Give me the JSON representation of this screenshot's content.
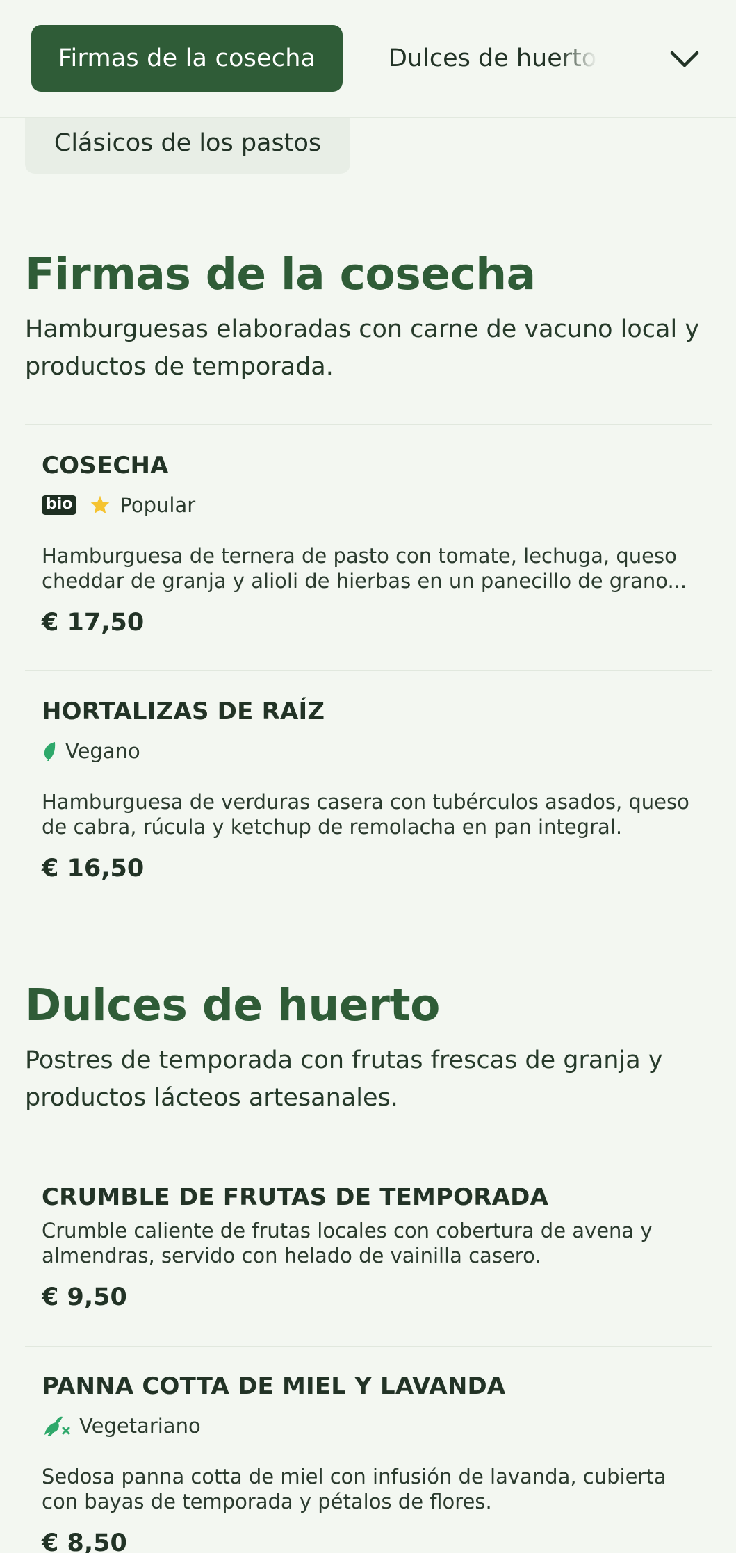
{
  "nav": {
    "tabs": [
      {
        "label": "Firmas de la cosecha",
        "active": true
      },
      {
        "label": "Dulces de huerto",
        "active": false
      },
      {
        "label": "Clásicos de los pastos",
        "active": false
      }
    ],
    "expand_icon": "chevron-down-icon"
  },
  "sections": [
    {
      "title": "Firmas de la cosecha",
      "description": "Hamburguesas elaboradas con carne de vacuno local y productos de temporada.",
      "items": [
        {
          "name": "COSECHA",
          "tags": [
            {
              "type": "bio",
              "label": "bio"
            },
            {
              "type": "star-icon",
              "label": "Popular"
            }
          ],
          "description": "Hamburguesa de ternera de pasto con tomate, lechuga, queso cheddar de granja y alioli de hierbas en un panecillo de grano...",
          "price": "€ 17,50"
        },
        {
          "name": "HORTALIZAS DE RAÍZ",
          "tags": [
            {
              "type": "leaf-icon",
              "label": "Vegano"
            }
          ],
          "description": "Hamburguesa de verduras casera con tubérculos asados, queso de cabra, rúcula y ketchup de remolacha en pan integral.",
          "price": "€ 16,50"
        }
      ]
    },
    {
      "title": "Dulces de huerto",
      "description": "Postres de temporada con frutas frescas de granja y productos lácteos artesanales.",
      "items": [
        {
          "name": "CRUMBLE DE FRUTAS DE TEMPORADA",
          "tags": [],
          "description": "Crumble caliente de frutas locales con cobertura de avena y almendras, servido con helado de vainilla casero.",
          "price": "€ 9,50"
        },
        {
          "name": "PANNA COTTA DE MIEL Y LAVANDA",
          "tags": [
            {
              "type": "vegetarian-icon",
              "label": "Vegetariano"
            }
          ],
          "description": "Sedosa panna cotta de miel con infusión de lavanda, cubierta con bayas de temporada y pétalos de flores.",
          "price": "€ 8,50"
        }
      ]
    }
  ],
  "colors": {
    "background": "#f3f7f1",
    "accent": "#2f5c37",
    "star": "#f5c330",
    "leaf": "#2ea86a"
  }
}
